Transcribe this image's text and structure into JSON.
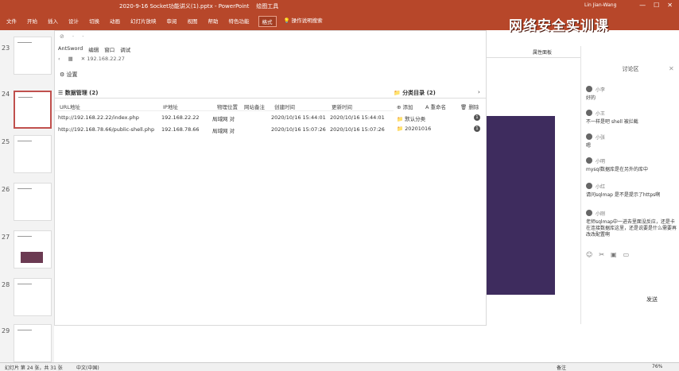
{
  "ribbon": {
    "doc_title": "2020-9-16 Socket功能讲义(1).pptx",
    "app_name": "PowerPoint",
    "tool_label": "绘图工具",
    "user": "Lin Jian-Wang",
    "watermark": "网络安全实训课",
    "tabs": [
      "文件",
      "开始",
      "插入",
      "设计",
      "切换",
      "动画",
      "幻灯片放映",
      "审阅",
      "视图",
      "帮助",
      "特色功能",
      "格式"
    ],
    "active_tab": "格式",
    "search_hint": "操作说明搜索"
  },
  "thumbnails": [
    {
      "num": "23"
    },
    {
      "num": "24"
    },
    {
      "num": "25"
    },
    {
      "num": "26"
    },
    {
      "num": "27"
    },
    {
      "num": "28"
    },
    {
      "num": "29"
    }
  ],
  "antsword": {
    "menu": [
      "AntSword",
      "编辑",
      "窗口",
      "调试"
    ],
    "address_tab": "192.168.22.27",
    "settings_label": "设置",
    "data_panel": "数据管理 (2)",
    "category_panel": "分类目录 (2)",
    "columns": [
      "URL地址",
      "IP地址",
      "物理位置",
      "网站备注",
      "创建时间",
      "更新时间"
    ],
    "rows": [
      {
        "url": "http://192.168.22.22/index.php",
        "ip": "192.168.22.22",
        "loc": "局域网 对",
        "created": "2020/10/16 15:44:01",
        "updated": "2020/10/16 15:44:01"
      },
      {
        "url": "http://192.168.78.66/public-shell.php",
        "ip": "192.168.78.66",
        "loc": "局域网 对",
        "created": "2020/10/16 15:07:26",
        "updated": "2020/10/16 15:07:26"
      }
    ],
    "category_actions": [
      "添加",
      "重命名",
      "删除"
    ],
    "categories": [
      {
        "name": "默认分类",
        "count": "1"
      },
      {
        "name": "20201016",
        "count": "1"
      }
    ]
  },
  "side_strip": {
    "label": "属性面板"
  },
  "discussion": {
    "title": "讨论区",
    "messages": [
      {
        "name": "小李",
        "text": "好的"
      },
      {
        "name": "小王",
        "text": "不一样是吧 shell 被拦截"
      },
      {
        "name": "小张",
        "text": "嗯"
      },
      {
        "name": "小明",
        "text": "mysql数据库是在另外的库中"
      },
      {
        "name": "小红",
        "text": "请问sqlmap 是不是提示了https啊"
      },
      {
        "name": "小刚",
        "text": "老师sqlmap中一进去里面没反应，还是卡在连接数据库这里，还是说要是什么需要再改改配置啊"
      }
    ],
    "send_label": "发送"
  },
  "status": {
    "slide_info": "幻灯片 第 24 张，共 31 张",
    "lang": "中文(中国)",
    "notes": "备注",
    "zoom": "76%"
  }
}
